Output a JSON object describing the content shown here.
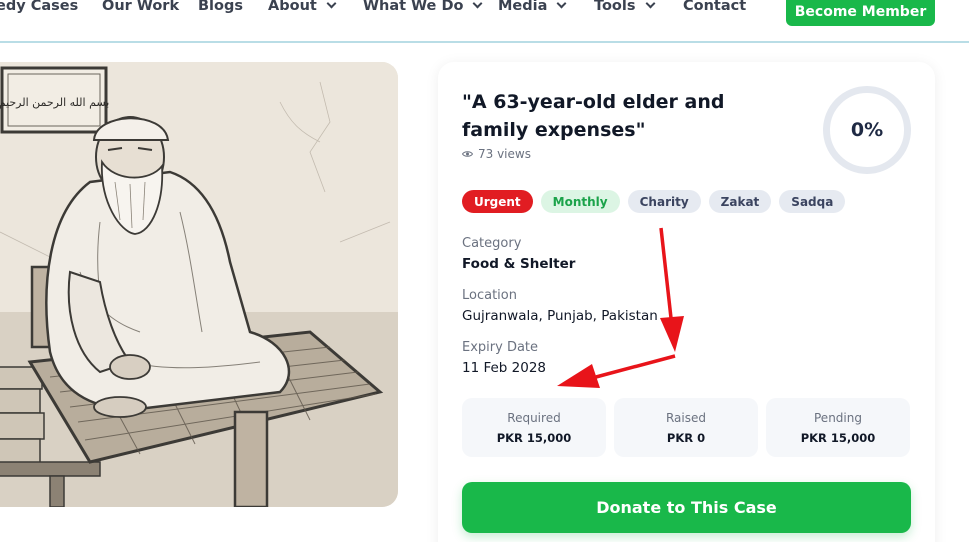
{
  "nav": {
    "items": [
      {
        "label": "edy Cases"
      },
      {
        "label": "Our Work"
      },
      {
        "label": "Blogs"
      },
      {
        "label": "About"
      },
      {
        "label": "What We Do"
      },
      {
        "label": "Media"
      },
      {
        "label": "Tools"
      },
      {
        "label": "Contact"
      }
    ],
    "cta_label": "Become Member"
  },
  "case": {
    "title": "\"A 63-year-old elder and family expenses\"",
    "views": "73 views",
    "progress_text": "0%",
    "progress_fraction": 0,
    "tags": [
      "Urgent",
      "Monthly",
      "Charity",
      "Zakat",
      "Sadqa"
    ],
    "category_label": "Category",
    "category_value": "Food & Shelter",
    "location_label": "Location",
    "location_value": "Gujranwala, Punjab, Pakistan",
    "expiry_label": "Expiry Date",
    "expiry_value": "11 Feb 2028",
    "stats": [
      {
        "label": "Required",
        "value": "PKR 15,000"
      },
      {
        "label": "Raised",
        "value": "PKR 0"
      },
      {
        "label": "Pending",
        "value": "PKR 15,000"
      }
    ],
    "donate_label": "Donate to This Case"
  },
  "image": {
    "calligraphy": "بسم الله الرحمن الرحيم"
  },
  "colors": {
    "brand_green": "#19b84a",
    "urgent_red": "#e11d22",
    "annotation_red": "#e8141a",
    "nav_border": "#b9dde6"
  }
}
